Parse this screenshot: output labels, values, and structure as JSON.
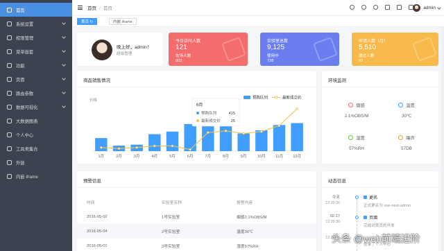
{
  "sidebar": {
    "items": [
      {
        "label": "首页",
        "icon": "home-icon",
        "active": true
      },
      {
        "label": "系统设置",
        "icon": "setting-icon",
        "arrow": true
      },
      {
        "label": "权限管理",
        "icon": "permission-icon",
        "arrow": true
      },
      {
        "label": "菜单嵌套",
        "icon": "menu-nest-icon",
        "arrow": true
      },
      {
        "label": "功能",
        "icon": "function-icon",
        "arrow": true
      },
      {
        "label": "页面",
        "icon": "page-icon",
        "arrow": true
      },
      {
        "label": "路由参数",
        "icon": "route-icon",
        "arrow": true
      },
      {
        "label": "数据可视化",
        "icon": "chart-icon",
        "arrow": true
      },
      {
        "label": "大数据图表",
        "icon": "big-data-icon"
      },
      {
        "label": "个人中心",
        "icon": "user-icon"
      },
      {
        "label": "工具类集合",
        "icon": "tools-icon"
      },
      {
        "label": "外链",
        "icon": "link-icon"
      },
      {
        "label": "内嵌 iframe",
        "icon": "iframe-icon"
      }
    ]
  },
  "topbar": {
    "breadcrumb": [
      "首页",
      "首页"
    ],
    "username": "admin"
  },
  "tags": [
    {
      "label": "首页",
      "active": true
    },
    {
      "label": "内嵌 iframe",
      "active": false
    }
  ],
  "welcome": {
    "greeting": "晚上好，admin！",
    "role": "超级管理"
  },
  "stats": [
    {
      "title": "今日访问人数",
      "value": "121",
      "sub_label": "在场人数",
      "sub_value": "602",
      "color": "#f56c6c"
    },
    {
      "title": "实验室总数",
      "value": "9,125",
      "sub_label": "使用中",
      "sub_value": "728",
      "color": "#6b7ef0"
    },
    {
      "title": "申请人数（月）",
      "value": "5,510",
      "sub_label": "通过人数",
      "sub_value": "92",
      "color": "#f7ba4a"
    }
  ],
  "sales": {
    "title": "商品销售情况"
  },
  "chart_data": {
    "type": "bar",
    "ylabel": "价格",
    "categories": [
      "1月",
      "2月",
      "3月",
      "4月",
      "5月",
      "6月",
      "7月",
      "8月",
      "9月",
      "10月",
      "11月",
      "12月"
    ],
    "series": [
      {
        "name": "预购队列",
        "type": "bar",
        "values": [
          200,
          85,
          100,
          260,
          300,
          415,
          400,
          400,
          270,
          320,
          400,
          430
        ],
        "color": "#409eff"
      },
      {
        "name": "最新成交价",
        "type": "line",
        "values": [
          55,
          40,
          55,
          80,
          80,
          25,
          285,
          310,
          270,
          300,
          390,
          650
        ],
        "color": "#f5c24c"
      }
    ],
    "ylim": [
      0,
      700
    ],
    "legend": "top-right",
    "tooltip": {
      "title": "6月",
      "rows": [
        {
          "label": "预购队列",
          "value": "415"
        },
        {
          "label": "最新成交价",
          "value": "25"
        }
      ]
    }
  },
  "env": {
    "title": "环境监测",
    "items": [
      {
        "name": "烟感",
        "value": "2.1%OBS/M",
        "icon": "smoke-icon",
        "color": "#f56c6c"
      },
      {
        "name": "温度",
        "value": "30℃",
        "icon": "thermometer-icon",
        "color": "#409eff"
      },
      {
        "name": "湿度",
        "value": "57%RH",
        "icon": "humidity-icon",
        "color": "#67c23a"
      },
      {
        "name": "噪声",
        "value": "57DB",
        "icon": "noise-icon",
        "color": "#e6a23c"
      }
    ]
  },
  "warning": {
    "title": "预警信息",
    "columns": [
      "时间",
      "实验室名称",
      "报警内容"
    ],
    "rows": [
      [
        "2016-05-02",
        "1号实验室",
        "烟感2.1%OBS/M"
      ],
      [
        "2016-05-04",
        "2号实验室",
        "温度30℃"
      ],
      [
        "2016-05-01",
        "3号实验室",
        "湿度57%RH"
      ]
    ]
  },
  "dynamic": {
    "title": "动态信息",
    "items": [
      {
        "time": "今天",
        "clock": "12:20:30",
        "title": "更名",
        "desc": "正式更名为 vue-next-admin"
      },
      {
        "time": "02-17",
        "clock": "12:20:30",
        "title": "页面",
        "desc": "完成对首页的开发"
      },
      {
        "time": "",
        "clock": "12:20:30",
        "title": "",
        "desc": "登录了个人中心"
      }
    ]
  },
  "watermark": "头条 @web前端进阶"
}
